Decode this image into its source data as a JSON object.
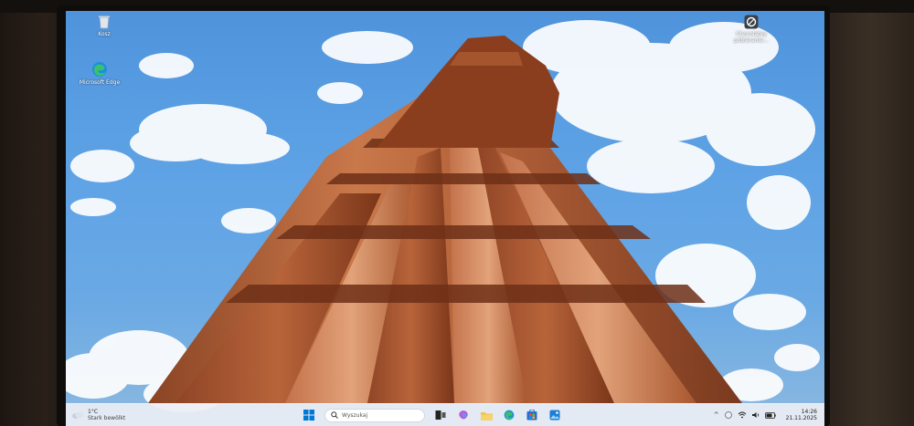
{
  "desktop": {
    "icons": [
      {
        "label": "Kosz",
        "icon": "recycle-bin-icon"
      },
      {
        "label": "Microsoft Edge",
        "icon": "edge-icon"
      },
      {
        "label": "Chocolatey pobieranie…",
        "icon": "app-shortcut-icon"
      }
    ]
  },
  "taskbar": {
    "weather": {
      "temperature": "1°C",
      "condition": "Stark bewölkt",
      "icon": "cloud-icon"
    },
    "search_placeholder": "Wyszukaj",
    "pinned": [
      "start-icon",
      "search-icon",
      "task-view-icon",
      "copilot-icon",
      "file-explorer-icon",
      "edge-icon",
      "store-icon",
      "photos-icon"
    ],
    "tray": {
      "chevron": "^",
      "time": "14:26",
      "date": "21.11.2025"
    }
  },
  "colors": {
    "sky": "#5fa3e6",
    "sandstone": "#b9663a",
    "taskbar": "#eceef4",
    "accent": "#0067c0"
  }
}
